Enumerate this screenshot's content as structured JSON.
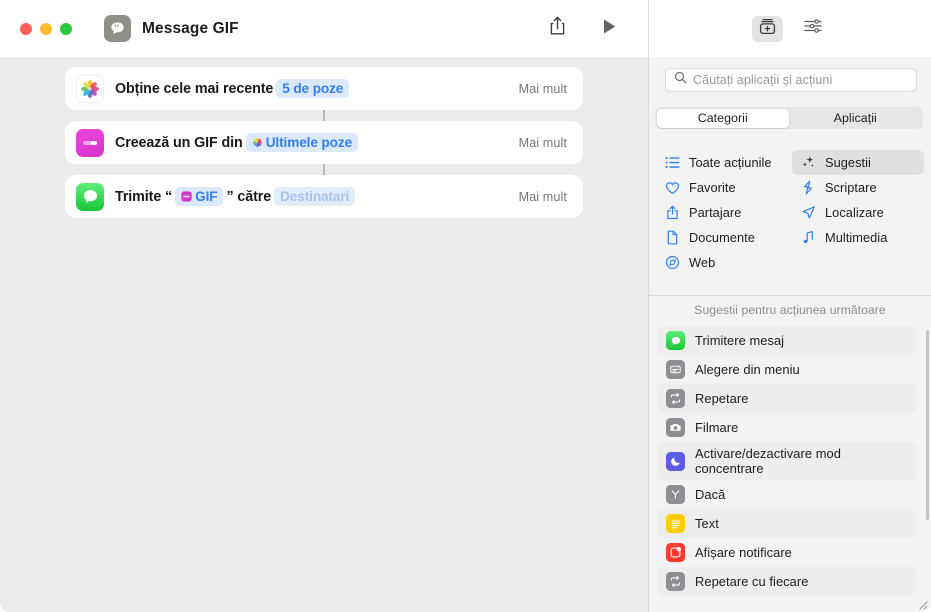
{
  "window": {
    "title": "Message GIF",
    "doc_icon": "messages-document-icon",
    "traffic_lights": [
      "close",
      "minimize",
      "maximize"
    ],
    "share_icon": "share-icon",
    "run_icon": "play-run-icon"
  },
  "workflow": {
    "more_label": "Mai mult",
    "actions": [
      {
        "icon": "photos-app-icon",
        "segments": [
          {
            "type": "text",
            "value": "Obține cele mai recente"
          },
          {
            "type": "pill",
            "value": "5 de poze",
            "style": "variable"
          }
        ]
      },
      {
        "icon": "gif-app-icon",
        "segments": [
          {
            "type": "text",
            "value": "Creează un GIF din"
          },
          {
            "type": "pill",
            "value": "Ultimele poze",
            "style": "variable",
            "pill_icon": "photos-token-icon"
          }
        ]
      },
      {
        "icon": "messages-app-icon",
        "segments": [
          {
            "type": "text",
            "value": "Trimite “"
          },
          {
            "type": "pill",
            "value": "GIF",
            "style": "variable",
            "pill_icon": "gif-token-icon"
          },
          {
            "type": "text",
            "value": "” către"
          },
          {
            "type": "pill",
            "value": "Destinatari",
            "style": "placeholder"
          }
        ]
      }
    ]
  },
  "library": {
    "toolbar": {
      "action_library_icon": "action-library-icon",
      "shortcut_details_icon": "sliders-icon"
    },
    "search": {
      "icon": "search-icon",
      "placeholder": "Căutați aplicații și acțiuni",
      "value": ""
    },
    "segmented": {
      "options": [
        "Categorii",
        "Aplicații"
      ],
      "selected": "Categorii"
    },
    "categories": [
      {
        "label": "Toate acțiunile",
        "icon": "list-bullet-icon",
        "selected": false
      },
      {
        "label": "Sugestii",
        "icon": "sparkles-icon",
        "selected": true
      },
      {
        "label": "Favorite",
        "icon": "heart-icon",
        "selected": false
      },
      {
        "label": "Scriptare",
        "icon": "scripting-bolt-icon",
        "selected": false
      },
      {
        "label": "Partajare",
        "icon": "share-icon",
        "selected": false
      },
      {
        "label": "Localizare",
        "icon": "location-arrow-icon",
        "selected": false
      },
      {
        "label": "Documente",
        "icon": "document-icon",
        "selected": false
      },
      {
        "label": "Multimedia",
        "icon": "music-note-icon",
        "selected": false
      },
      {
        "label": "Web",
        "icon": "compass-icon",
        "selected": false
      }
    ],
    "suggestions_header": "Sugestii pentru acțiunea următoare",
    "suggestions": [
      {
        "label": "Trimitere mesaj",
        "icon": "messages-app-icon",
        "color": "green"
      },
      {
        "label": "Alegere din meniu",
        "icon": "menu-picker-icon",
        "color": "gray"
      },
      {
        "label": "Repetare",
        "icon": "repeat-icon",
        "color": "gray"
      },
      {
        "label": "Filmare",
        "icon": "camera-icon",
        "color": "gray"
      },
      {
        "label": "Activare/dezactivare mod concentrare",
        "icon": "focus-moon-icon",
        "color": "purple"
      },
      {
        "label": "Dacă",
        "icon": "if-branch-icon",
        "color": "gray"
      },
      {
        "label": "Text",
        "icon": "text-lines-icon",
        "color": "yellow"
      },
      {
        "label": "Afișare notificare",
        "icon": "notification-icon",
        "color": "red"
      },
      {
        "label": "Repetare cu fiecare",
        "icon": "repeat-each-icon",
        "color": "gray"
      }
    ]
  },
  "colors": {
    "accent_blue": "#2f7ff6",
    "pill_background": "#dce9fd",
    "placeholder_pill": "#e2ecfb",
    "messages_green": "#1cc437",
    "gif_magenta": "#d935cf",
    "focus_purple": "#5e5ce6",
    "text_yellow": "#ffcc00",
    "notification_red": "#ff3b30",
    "pane_background": "#ececec",
    "library_background": "#f3f3f3"
  }
}
